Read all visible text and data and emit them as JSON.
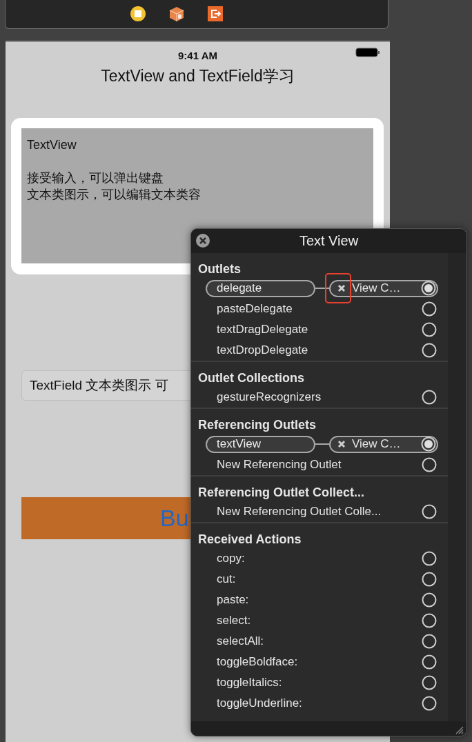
{
  "phone": {
    "status_time": "9:41 AM",
    "title": "TextView and TextField学习",
    "text_view": {
      "heading": "TextView",
      "lines": [
        "接受输入，可以弹出键盘",
        "文本类图示，可以编辑文本类容"
      ]
    },
    "text_field": {
      "value": "TextField 文本类图示 可"
    },
    "button": {
      "label": "Bu"
    }
  },
  "connections_panel": {
    "title": "Text View",
    "sections": [
      {
        "title": "Outlets",
        "items": [
          {
            "label": "delegate",
            "connected": true,
            "target": "View C…",
            "highlighted": true
          },
          {
            "label": "pasteDelegate",
            "connected": false
          },
          {
            "label": "textDragDelegate",
            "connected": false
          },
          {
            "label": "textDropDelegate",
            "connected": false
          }
        ]
      },
      {
        "title": "Outlet Collections",
        "items": [
          {
            "label": "gestureRecognizers",
            "connected": false
          }
        ]
      },
      {
        "title": "Referencing Outlets",
        "items": [
          {
            "label": "textView",
            "connected": true,
            "target": "View C…"
          },
          {
            "label": "New Referencing Outlet",
            "connected": false
          }
        ]
      },
      {
        "title": "Referencing Outlet Collect...",
        "items": [
          {
            "label": "New Referencing Outlet Colle...",
            "connected": false
          }
        ]
      },
      {
        "title": "Received Actions",
        "items": [
          {
            "label": "copy:",
            "connected": false
          },
          {
            "label": "cut:",
            "connected": false
          },
          {
            "label": "paste:",
            "connected": false
          },
          {
            "label": "select:",
            "connected": false
          },
          {
            "label": "selectAll:",
            "connected": false
          },
          {
            "label": "toggleBoldface:",
            "connected": false
          },
          {
            "label": "toggleItalics:",
            "connected": false
          },
          {
            "label": "toggleUnderline:",
            "connected": false
          }
        ]
      }
    ]
  }
}
